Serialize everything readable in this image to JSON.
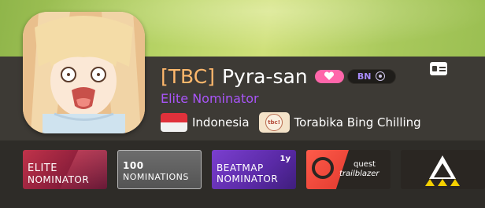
{
  "profile": {
    "clan_tag": "[TBC]",
    "username": "Pyra-san",
    "title": "Elite Nominator",
    "group_badge": "BN",
    "country": "Indonesia",
    "team_flag_text": "tbc!",
    "team": "Torabika Bing Chilling"
  },
  "badges": [
    {
      "line1": "ELITE",
      "line2": "NOMINATOR"
    },
    {
      "line1": "100",
      "line2": "NOMINATIONS"
    },
    {
      "line1": "BEATMAP",
      "line2": "NOMINATOR",
      "corner": "1y"
    },
    {
      "line1": "quest",
      "line2": "trailblazer"
    },
    {
      "name": "triangle-badge"
    }
  ],
  "icons": [
    "heart-icon",
    "osu-mode-icon",
    "profile-card-icon",
    "indonesia-flag-icon"
  ],
  "colors": {
    "clan_tag": "#ffb86c",
    "title": "#a855f7",
    "supporter": "#ff66aa",
    "group": "#a78bfa"
  }
}
